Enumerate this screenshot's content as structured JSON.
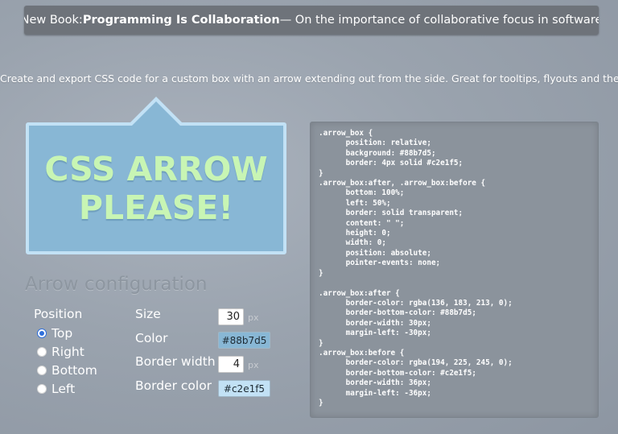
{
  "banner": {
    "prefix": "New Book: ",
    "book_title": "Programming Is Collaboration",
    "suffix": " — On the importance of collaborative focus in software"
  },
  "tagline": "Create and export CSS code for a custom box with an arrow extending out from the side. Great for tooltips, flyouts and the like.",
  "preview": {
    "line1": "CSS ARROW",
    "line2": "PLEASE!",
    "background": "#88b7d5",
    "border_color": "#c2e1f5",
    "text_color": "#c8f5b4"
  },
  "config": {
    "heading": "Arrow configuration",
    "position_label": "Position",
    "positions": [
      {
        "label": "Top",
        "checked": true
      },
      {
        "label": "Right",
        "checked": false
      },
      {
        "label": "Bottom",
        "checked": false
      },
      {
        "label": "Left",
        "checked": false
      }
    ],
    "size_label": "Size",
    "size_value": "30",
    "size_unit": "px",
    "color_label": "Color",
    "color_value": "#88b7d5",
    "border_width_label": "Border width",
    "border_width_value": "4",
    "border_width_unit": "px",
    "border_color_label": "Border color",
    "border_color_value": "#c2e1f5"
  },
  "code": ".arrow_box {\n\tposition: relative;\n\tbackground: #88b7d5;\n\tborder: 4px solid #c2e1f5;\n}\n.arrow_box:after, .arrow_box:before {\n\tbottom: 100%;\n\tleft: 50%;\n\tborder: solid transparent;\n\tcontent: \" \";\n\theight: 0;\n\twidth: 0;\n\tposition: absolute;\n\tpointer-events: none;\n}\n\n.arrow_box:after {\n\tborder-color: rgba(136, 183, 213, 0);\n\tborder-bottom-color: #88b7d5;\n\tborder-width: 30px;\n\tmargin-left: -30px;\n}\n.arrow_box:before {\n\tborder-color: rgba(194, 225, 245, 0);\n\tborder-bottom-color: #c2e1f5;\n\tborder-width: 36px;\n\tmargin-left: -36px;\n}"
}
